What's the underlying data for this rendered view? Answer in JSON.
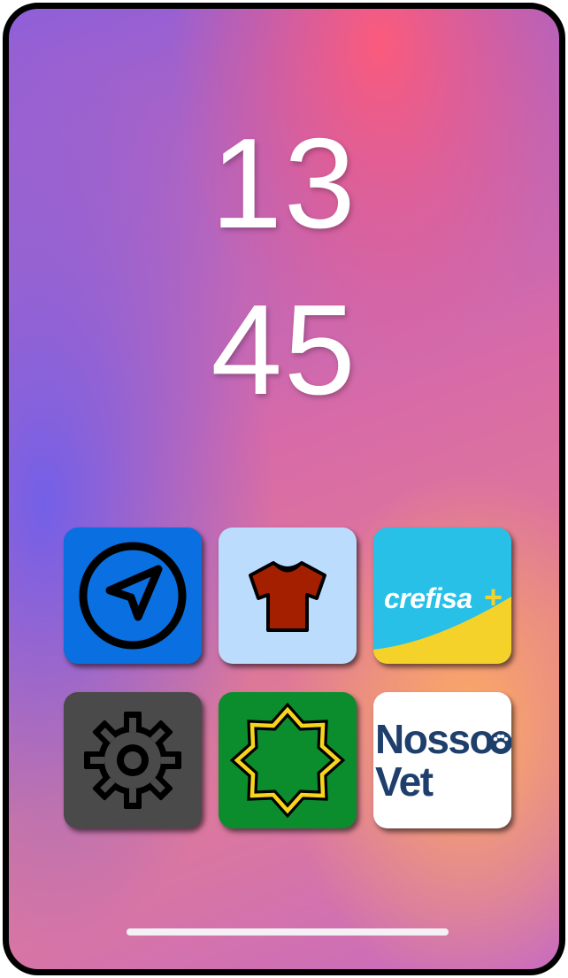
{
  "clock": {
    "hour": "13",
    "minute": "45"
  },
  "apps": [
    {
      "name": "location",
      "icon": "navigation-arrow-icon",
      "bg": "#0a6fe0"
    },
    {
      "name": "clothing",
      "icon": "tshirt-icon",
      "bg": "#bcdcfd"
    },
    {
      "name": "crefisa",
      "icon": "crefisa-logo",
      "label": "crefisa",
      "plus": "+",
      "bg": "#28c0e6",
      "accent": "#f5d22a"
    },
    {
      "name": "settings",
      "icon": "gear-icon",
      "bg": "#4a4a4a"
    },
    {
      "name": "islamic",
      "icon": "octagram-star-icon",
      "bg": "#0b8d2e",
      "accent": "#f7d51c"
    },
    {
      "name": "nossovet",
      "icon": "nossovet-logo",
      "line1": "Nosso",
      "line2": "Vet",
      "text_color": "#1e3f6c"
    }
  ]
}
